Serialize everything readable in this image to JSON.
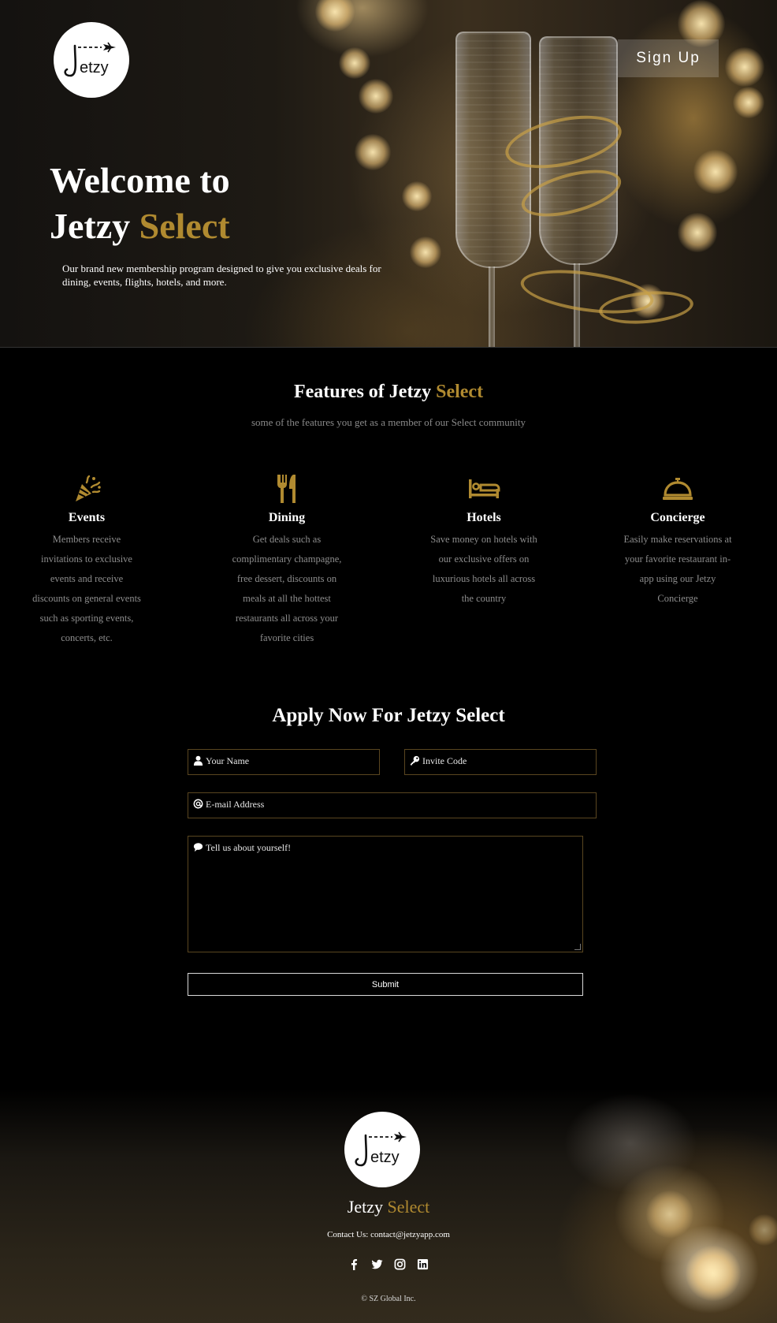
{
  "hero": {
    "title_line1": "Welcome to",
    "title_word": "Jetzy",
    "title_accent": "Select",
    "subtitle": "Our brand new membership program designed to give you exclusive deals for dining, events, flights, hotels, and more.",
    "signup_label": "Sign Up",
    "logo_text": "etzy"
  },
  "features": {
    "title_main": "Features of Jetzy",
    "title_accent": "Select",
    "subtitle": "some of the features you get as a member of our Select community",
    "items": [
      {
        "icon": "party-popper-icon",
        "title": "Events",
        "description": "Members receive invitations to exclusive events and receive discounts on general events such as sporting events, concerts, etc."
      },
      {
        "icon": "utensils-icon",
        "title": "Dining",
        "description": "Get deals such as complimentary champagne, free dessert, discounts on meals at all the hottest restaurants all across your favorite cities"
      },
      {
        "icon": "bed-icon",
        "title": "Hotels",
        "description": "Save money on hotels with our exclusive offers on luxurious hotels all across the country"
      },
      {
        "icon": "concierge-bell-icon",
        "title": "Concierge",
        "description": "Easily make reservations at your favorite restaurant in-app using our Jetzy Concierge"
      }
    ]
  },
  "form": {
    "title": "Apply Now For Jetzy Select",
    "name_placeholder": "Your Name",
    "code_placeholder": "Invite Code",
    "email_placeholder": "E-mail Address",
    "message_placeholder": "Tell us about yourself!",
    "submit_label": "Submit"
  },
  "footer": {
    "brand_word": "Jetzy",
    "brand_accent": "Select",
    "contact": "Contact Us: contact@jetzyapp.com",
    "social_icons": [
      "facebook-icon",
      "twitter-icon",
      "instagram-icon",
      "linkedin-icon"
    ],
    "copyright": "© SZ Global Inc.",
    "logo_text": "etzy"
  },
  "colors": {
    "accent": "#b08a30",
    "background": "#000000"
  }
}
